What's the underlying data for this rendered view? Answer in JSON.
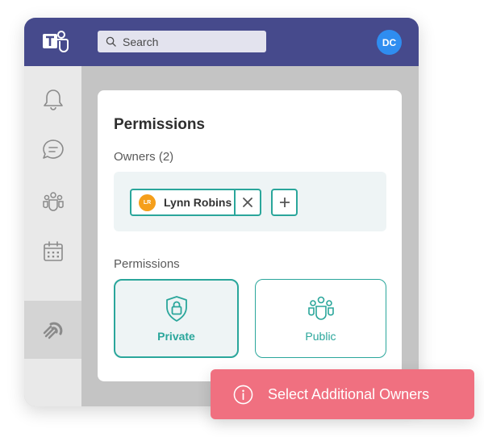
{
  "header": {
    "search_placeholder": "Search",
    "user_initials": "DC",
    "avatar_color": "#2f8df0",
    "bar_color": "#464a8c"
  },
  "rail": {
    "items": [
      {
        "icon": "bell-icon"
      },
      {
        "icon": "chat-icon"
      },
      {
        "icon": "teams-icon"
      },
      {
        "icon": "calendar-icon"
      },
      {
        "icon": "app-logo-icon",
        "active": true
      }
    ]
  },
  "card": {
    "title": "Permissions",
    "owners_label": "Owners (2)",
    "owners": [
      {
        "initials": "LR",
        "name": "Lynn Robins",
        "avatar_color": "#f59f1b"
      }
    ],
    "permissions_label": "Permissions",
    "options": [
      {
        "label": "Private",
        "icon": "lock-shield-icon",
        "selected": true
      },
      {
        "label": "Public",
        "icon": "group-icon",
        "selected": false
      }
    ],
    "accent_color": "#2aa69b"
  },
  "toast": {
    "message": "Select Additional Owners",
    "icon": "info-icon",
    "color": "#f07080"
  }
}
